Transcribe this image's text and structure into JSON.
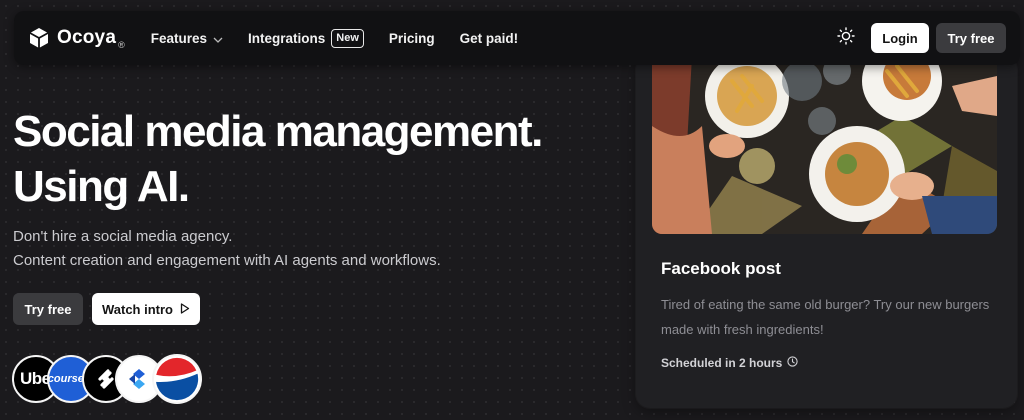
{
  "brand": {
    "name": "Ocoya",
    "reg": "®",
    "icon": "cube-logo-icon"
  },
  "nav": {
    "features": "Features",
    "integrations": "Integrations",
    "integrations_badge": "New",
    "pricing": "Pricing",
    "get_paid": "Get paid!"
  },
  "header_actions": {
    "login": "Login",
    "try_free": "Try free",
    "theme_icon": "sun-icon"
  },
  "hero": {
    "title_line1": "Social media management.",
    "title_line2": "Using AI.",
    "subtitle_line1": "Don't hire a social media agency.",
    "subtitle_line2": "Content creation and engagement with AI agents and workflows.",
    "try_free": "Try free",
    "watch_intro": "Watch intro"
  },
  "logos": {
    "uber": "Ube",
    "coursera": "coursera"
  },
  "card": {
    "title": "Facebook post",
    "body": "Tired of eating the same old burger? Try our new burgers made with fresh ingredients!",
    "status": "Scheduled in 2 hours"
  },
  "colors": {
    "background": "#1b1a1d",
    "navbar": "#111113",
    "card": "#202023",
    "secondary_button": "#3b3b3e"
  }
}
